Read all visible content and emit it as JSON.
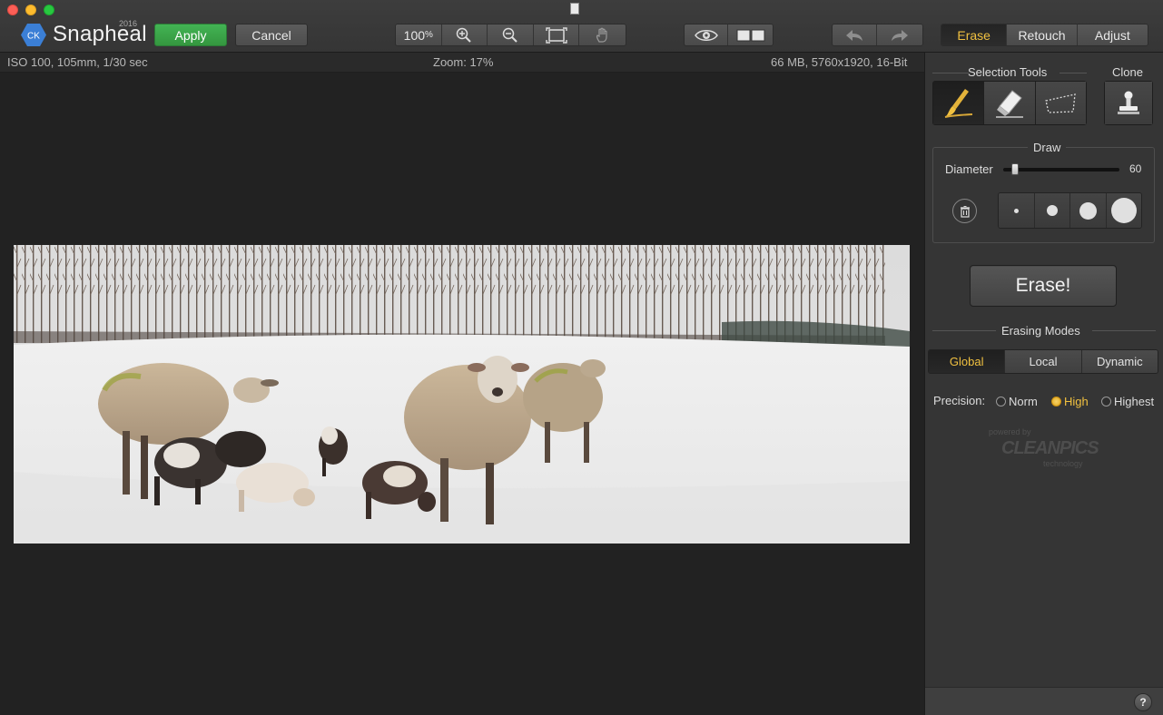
{
  "app": {
    "name": "Snapheal",
    "year": "2016",
    "logo_text": "CK"
  },
  "toolbar": {
    "apply_label": "Apply",
    "cancel_label": "Cancel",
    "zoom_value": "100",
    "zoom_unit": "%",
    "tabs": [
      {
        "label": "Erase",
        "active": true
      },
      {
        "label": "Retouch",
        "active": false
      },
      {
        "label": "Adjust",
        "active": false
      }
    ]
  },
  "infobar": {
    "exif": "ISO 100, 105mm, 1/30 sec",
    "zoom": "Zoom: 17%",
    "fileinfo": "66 MB, 5760x1920, 16-Bit"
  },
  "panel": {
    "selection_tools_label": "Selection Tools",
    "clone_label": "Clone",
    "draw_label": "Draw",
    "diameter_label": "Diameter",
    "diameter_value": "60",
    "diameter_fraction": 0.1,
    "erase_button": "Erase!",
    "erasing_modes_label": "Erasing Modes",
    "modes": [
      {
        "label": "Global",
        "active": true
      },
      {
        "label": "Local",
        "active": false
      },
      {
        "label": "Dynamic",
        "active": false
      }
    ],
    "precision_label": "Precision:",
    "precision_options": [
      {
        "label": "Norm",
        "selected": false
      },
      {
        "label": "High",
        "selected": true
      },
      {
        "label": "Highest",
        "selected": false
      }
    ],
    "powered_by": "powered by",
    "cleanpics": "CLEANPICS",
    "technology": "technology",
    "help": "?"
  },
  "colors": {
    "accent": "#f0c040",
    "apply_green": "#3aa648"
  }
}
